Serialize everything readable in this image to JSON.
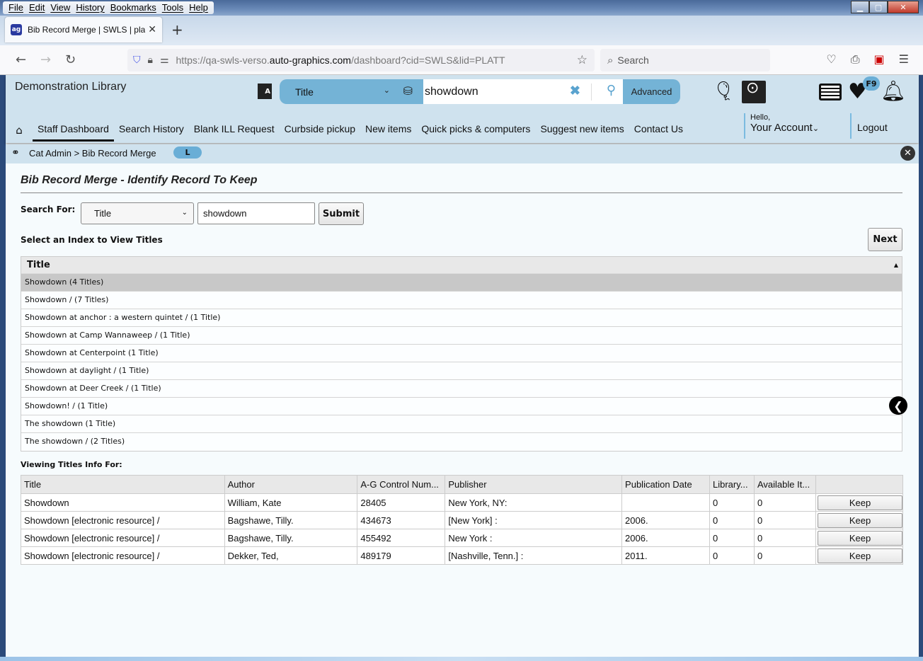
{
  "browser": {
    "menu": [
      "File",
      "Edit",
      "View",
      "History",
      "Bookmarks",
      "Tools",
      "Help"
    ],
    "tab_title": "Bib Record Merge | SWLS | platt",
    "url_prefix": "https://qa-swls-verso.",
    "url_domain": "auto-graphics.com",
    "url_suffix": "/dashboard?cid=SWLS&lid=PLATT",
    "search_placeholder": "Search"
  },
  "header": {
    "library_name": "Demonstration Library",
    "search_type": "Title",
    "search_query": "showdown",
    "advanced_label": "Advanced",
    "badge": "F9",
    "hello": "Hello,",
    "account": "Your Account",
    "logout": "Logout"
  },
  "nav": {
    "items": [
      "Staff Dashboard",
      "Search History",
      "Blank ILL Request",
      "Curbside pickup",
      "New items",
      "Quick picks & computers",
      "Suggest new items",
      "Contact Us"
    ],
    "active": 0
  },
  "breadcrumb": {
    "path": "Cat Admin > Bib Record Merge",
    "badge": "L"
  },
  "main": {
    "title": "Bib Record Merge - Identify Record To Keep",
    "search_for_label": "Search For:",
    "search_field": "Title",
    "search_value": "showdown",
    "submit_label": "Submit",
    "index_label": "Select an Index to View Titles",
    "next_label": "Next",
    "index_header": "Title",
    "index_rows": [
      "Showdown (4 Titles)",
      "Showdown / (7 Titles)",
      "Showdown at anchor : a western quintet / (1 Title)",
      "Showdown at Camp Wannaweep / (1 Title)",
      "Showdown at Centerpoint (1 Title)",
      "Showdown at daylight / (1 Title)",
      "Showdown at Deer Creek / (1 Title)",
      "Showdown! / (1 Title)",
      "The showdown (1 Title)",
      "The showdown / (2 Titles)"
    ],
    "selected_index": 0,
    "viewing_label": "Viewing Titles Info For:",
    "columns": [
      "Title",
      "Author",
      "A-G Control Num...",
      "Publisher",
      "Publication Date",
      "Library...",
      "Available It...",
      ""
    ],
    "rows": [
      {
        "title": "Showdown",
        "author": "William, Kate",
        "control": "28405",
        "publisher": "New York, NY:",
        "date": "",
        "library": "0",
        "available": "0",
        "action": "Keep"
      },
      {
        "title": "Showdown [electronic resource] /",
        "author": "Bagshawe, Tilly.",
        "control": "434673",
        "publisher": "[New York] :",
        "date": "2006.",
        "library": "0",
        "available": "0",
        "action": "Keep"
      },
      {
        "title": "Showdown [electronic resource] /",
        "author": "Bagshawe, Tilly.",
        "control": "455492",
        "publisher": "New York :",
        "date": "2006.",
        "library": "0",
        "available": "0",
        "action": "Keep"
      },
      {
        "title": "Showdown [electronic resource] /",
        "author": "Dekker, Ted,",
        "control": "489179",
        "publisher": "[Nashville, Tenn.] :",
        "date": "2011.",
        "library": "0",
        "available": "0",
        "action": "Keep"
      }
    ]
  }
}
